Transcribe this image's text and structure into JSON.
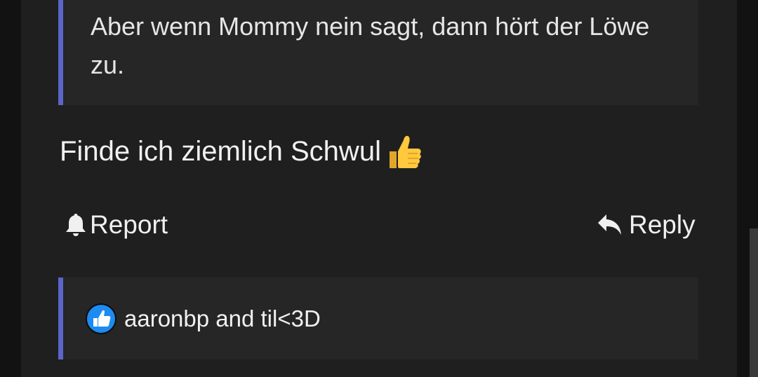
{
  "quote": {
    "text": "Aber wenn Mommy nein sagt, dann hört der Löwe zu."
  },
  "message": {
    "text": "Finde ich ziemlich Schwul",
    "emoji": "thumbs-up-icon"
  },
  "actions": {
    "report_label": "Report",
    "report_icon": "bell-icon",
    "reply_label": "Reply",
    "reply_icon": "reply-arrow-icon"
  },
  "reactions": {
    "icon": "like-badge-icon",
    "users_text": "aaronbp and til<3D"
  },
  "colors": {
    "accent_bar": "#5b66c8",
    "like_badge": "#1d8bf1",
    "emoji_yellow": "#ffc83d"
  }
}
